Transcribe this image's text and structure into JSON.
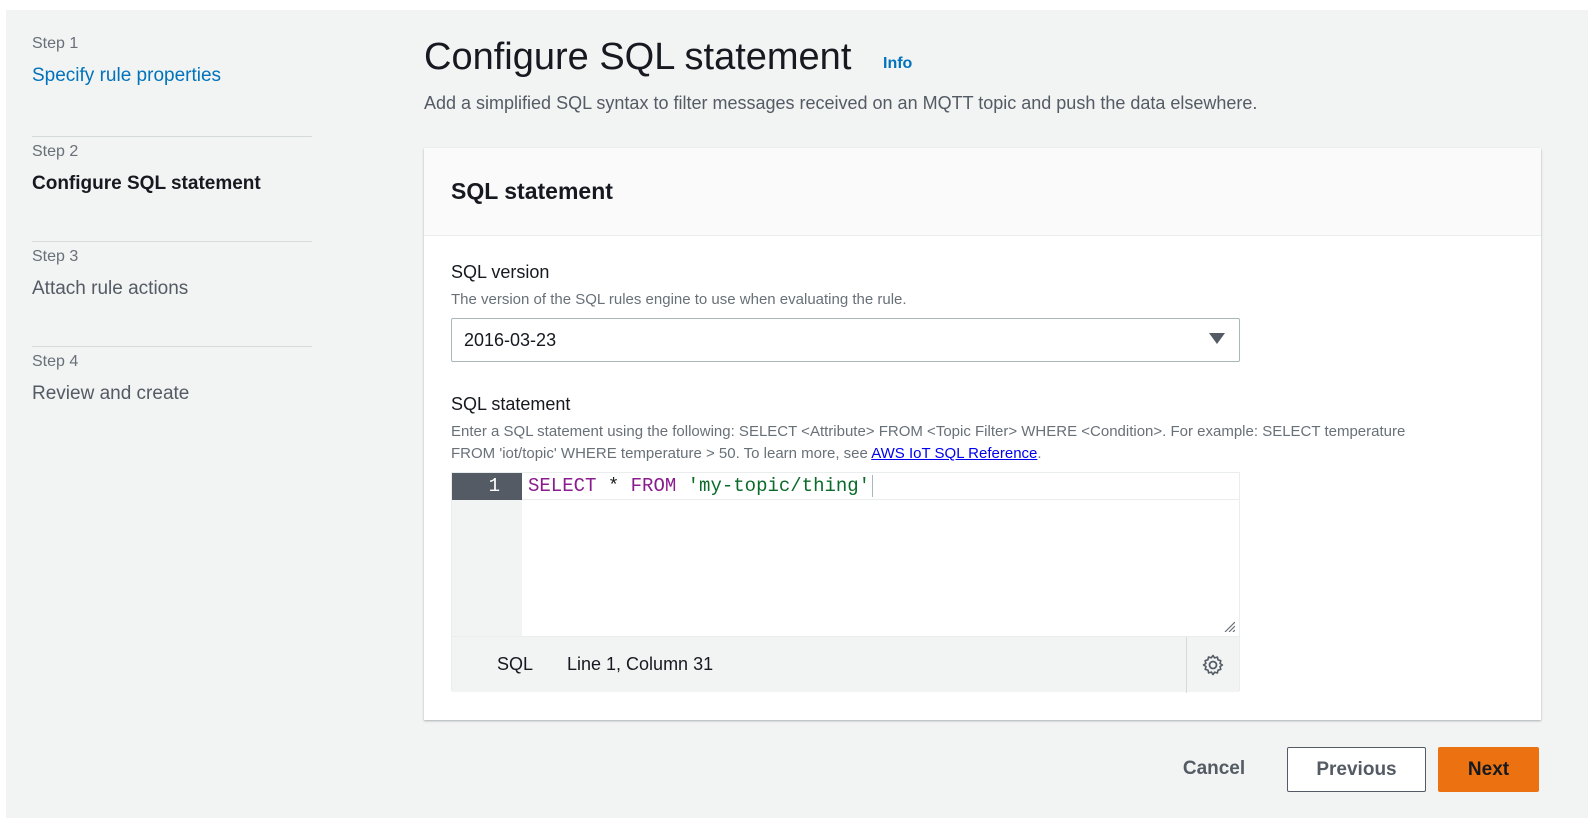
{
  "steps": [
    {
      "number": "Step 1",
      "title": "Specify rule properties",
      "state": "link"
    },
    {
      "number": "Step 2",
      "title": "Configure SQL statement",
      "state": "current"
    },
    {
      "number": "Step 3",
      "title": "Attach rule actions",
      "state": "upcoming"
    },
    {
      "number": "Step 4",
      "title": "Review and create",
      "state": "upcoming"
    }
  ],
  "header": {
    "title": "Configure SQL statement",
    "info": "Info",
    "description": "Add a simplified SQL syntax to filter messages received on an MQTT topic and push the data elsewhere."
  },
  "container": {
    "title": "SQL statement",
    "sql_version": {
      "label": "SQL version",
      "description": "The version of the SQL rules engine to use when evaluating the rule.",
      "value": "2016-03-23"
    },
    "sql_statement": {
      "label": "SQL statement",
      "description_prefix": "Enter a SQL statement using the following: SELECT <Attribute> FROM <Topic Filter> WHERE <Condition>. For example: SELECT temperature FROM 'iot/topic' WHERE temperature > 50. To learn more, see ",
      "link_text": "AWS IoT SQL Reference",
      "description_suffix": ".",
      "editor": {
        "line_number": "1",
        "tokens": {
          "select": "SELECT",
          "star": " * ",
          "from": "FROM",
          "space": " ",
          "topic": "'my-topic/thing'"
        },
        "language": "SQL",
        "cursor_position": "Line 1, Column 31"
      }
    }
  },
  "buttons": {
    "cancel": "Cancel",
    "previous": "Previous",
    "next": "Next"
  },
  "colors": {
    "link": "#0073bb",
    "primary_button": "#ec7211",
    "keyword": "#8a1c8e",
    "string": "#0b6b2a"
  }
}
